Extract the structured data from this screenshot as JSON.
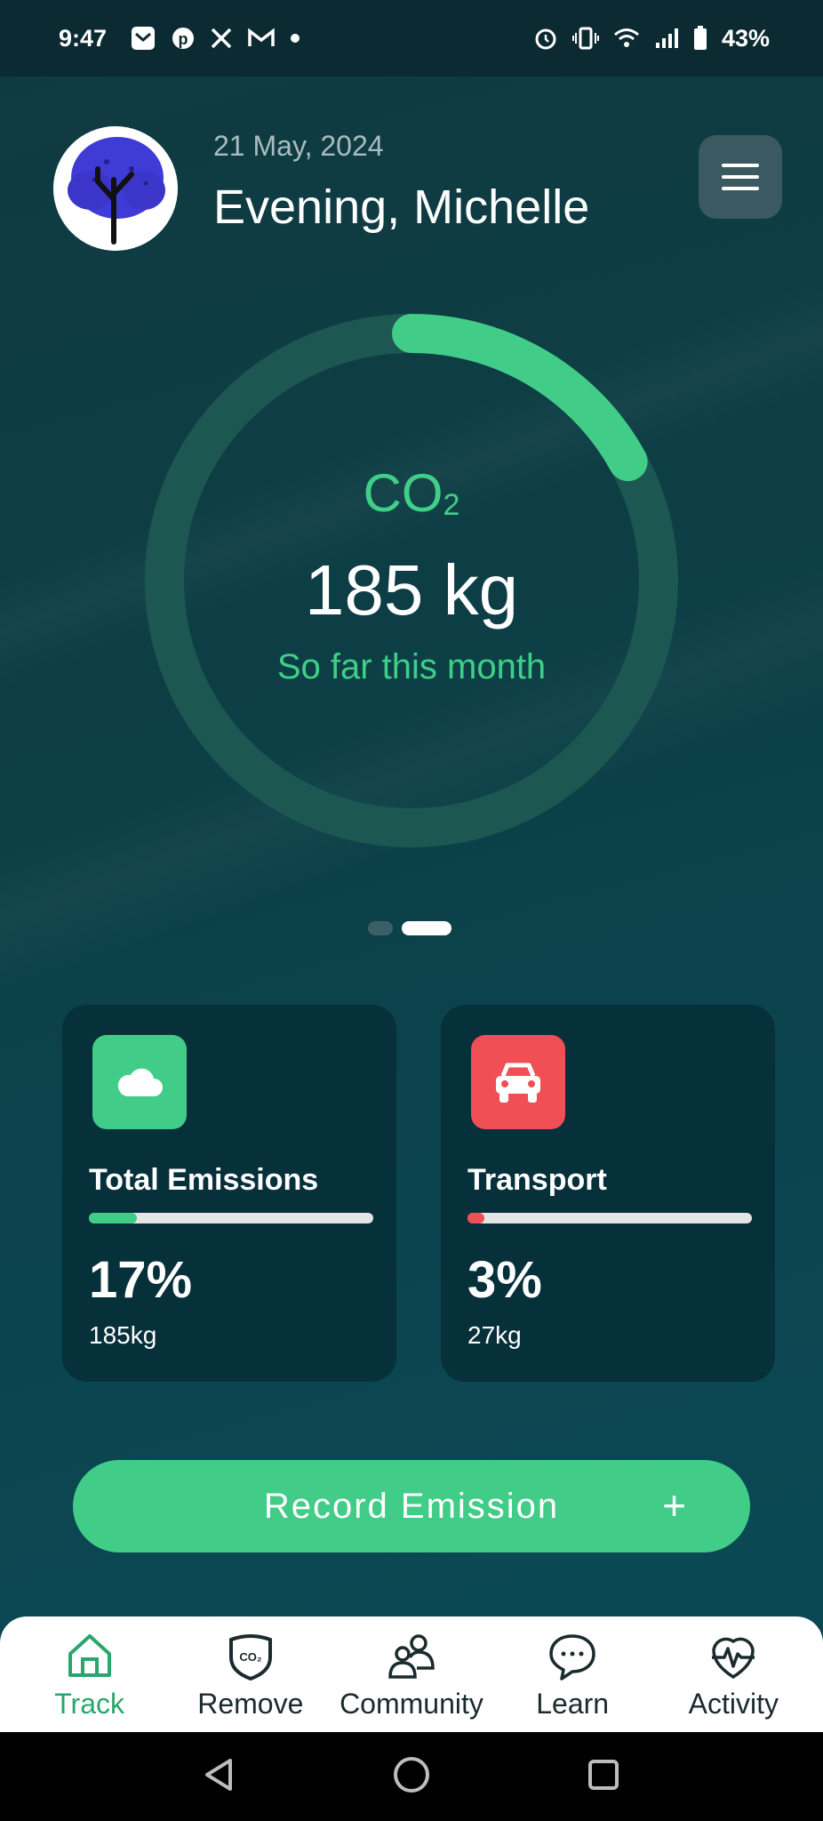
{
  "status_bar": {
    "time": "9:47",
    "battery": "43%",
    "left_icons": [
      "mail-icon",
      "pinterest-icon",
      "x-icon",
      "gmail-icon",
      "dot-icon"
    ],
    "right_icons": [
      "alarm-icon",
      "vibrate-icon",
      "wifi-icon",
      "signal-icon",
      "battery-icon"
    ]
  },
  "header": {
    "date": "21 May, 2024",
    "greeting": "Evening, Michelle",
    "avatar_icon": "tree-avatar-icon",
    "menu_icon": "hamburger-menu-icon"
  },
  "gauge": {
    "label_main": "CO",
    "label_sub": "2",
    "value": "185 kg",
    "caption": "So far this month",
    "progress_fraction": 0.17,
    "track_color": "#1d5752",
    "fill_color": "#41cc87"
  },
  "pager": {
    "pages": 2,
    "active_index": 1
  },
  "cards": [
    {
      "title": "Total Emissions",
      "percent_text": "17%",
      "percent": 17,
      "amount": "185kg",
      "icon": "cloud-icon",
      "color": "#41cc87"
    },
    {
      "title": "Transport",
      "percent_text": "3%",
      "percent": 3,
      "amount": "27kg",
      "icon": "car-icon",
      "color": "#f04f55"
    }
  ],
  "record_button": {
    "label": "Record Emission",
    "plus": "+"
  },
  "bottom_nav": {
    "items": [
      {
        "label": "Track",
        "icon": "home-icon",
        "active": true
      },
      {
        "label": "Remove",
        "icon": "co2-shield-icon",
        "active": false
      },
      {
        "label": "Community",
        "icon": "people-icon",
        "active": false
      },
      {
        "label": "Learn",
        "icon": "chat-bubble-icon",
        "active": false
      },
      {
        "label": "Activity",
        "icon": "activity-pulse-icon",
        "active": false
      }
    ]
  },
  "system_nav": [
    "back-icon",
    "home-circle-icon",
    "recents-icon"
  ]
}
